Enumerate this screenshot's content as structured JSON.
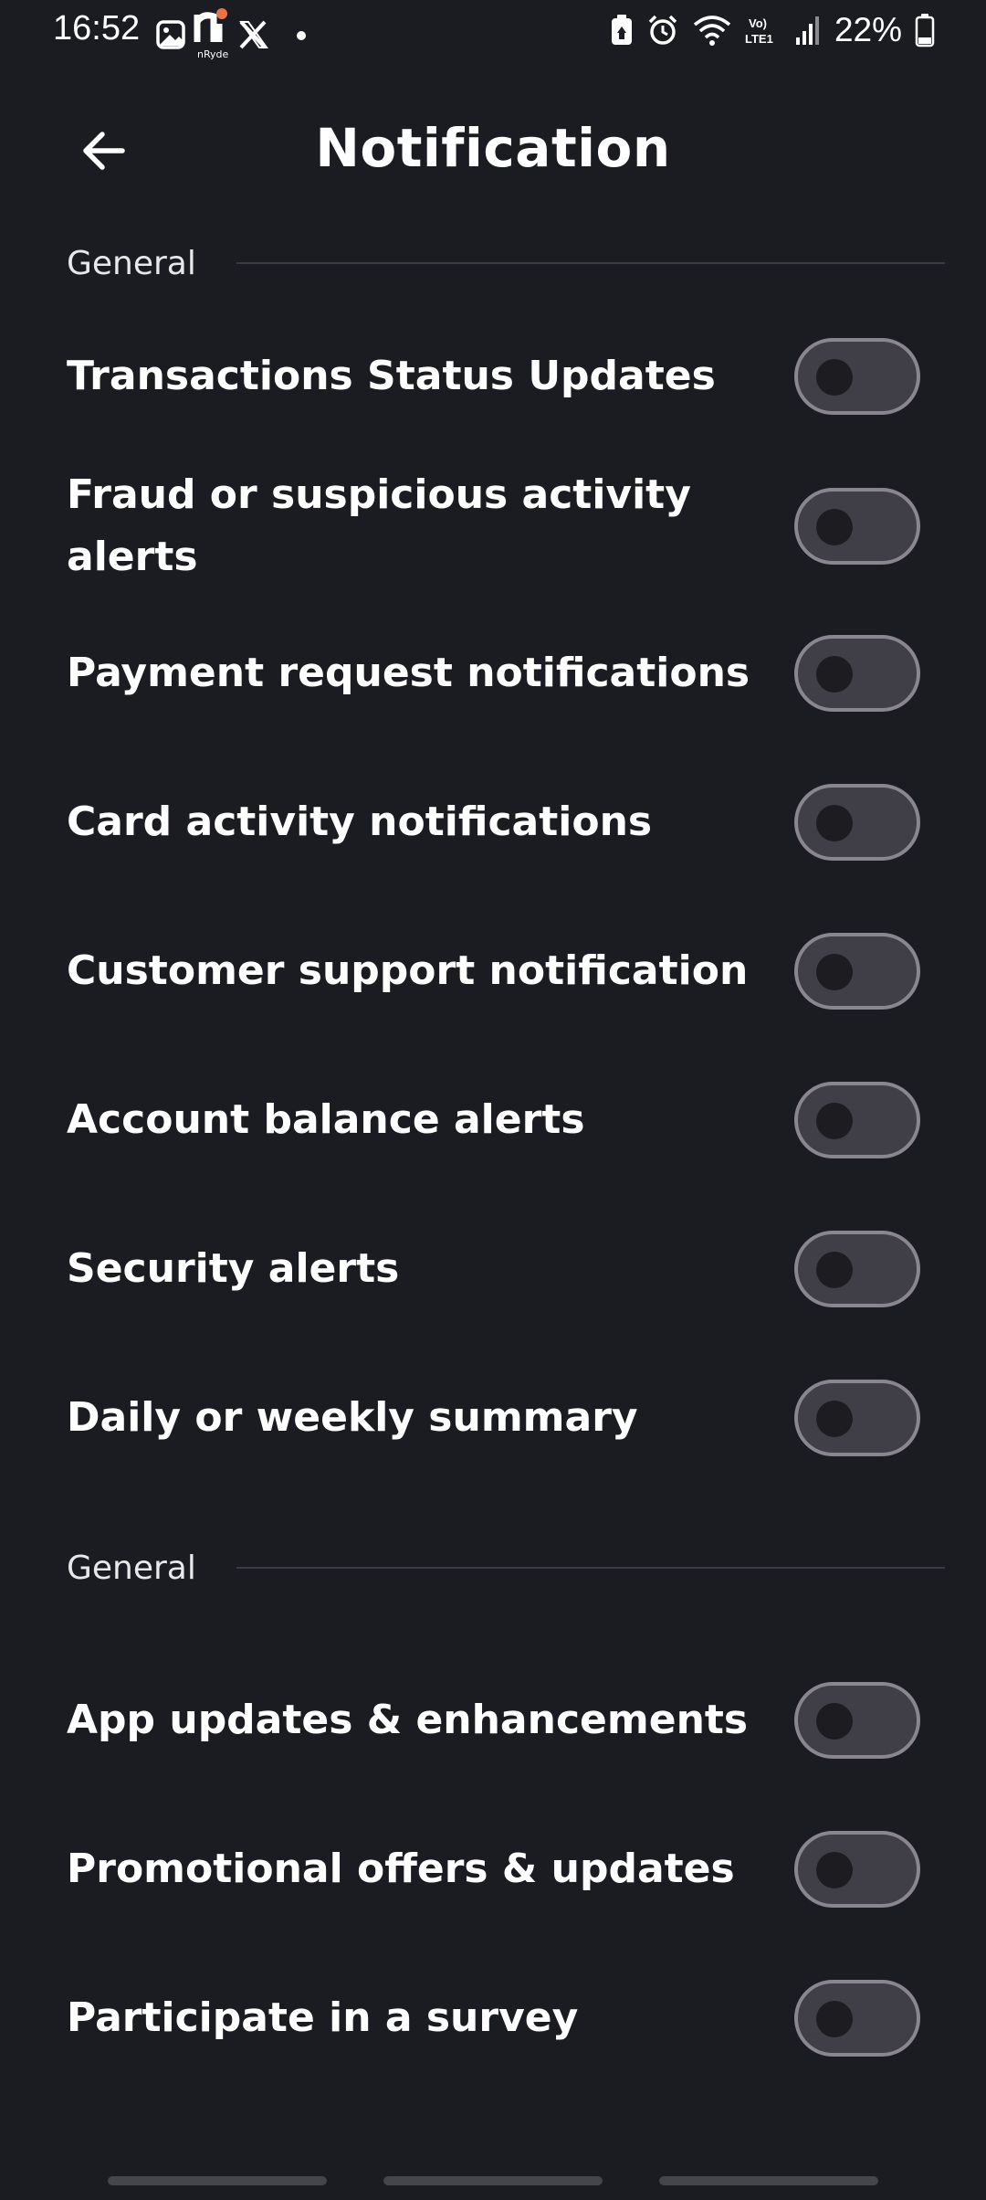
{
  "status_bar": {
    "time": "16:52",
    "battery": "22%",
    "left_icons": [
      "gallery-icon",
      "nryde-app-icon",
      "x-app-icon",
      "dot-icon"
    ],
    "nryde_caption": "nRyde",
    "right_icons": [
      "battery-saver-icon",
      "alarm-icon",
      "wifi-icon",
      "volte-icon",
      "signal-icon",
      "battery-icon"
    ],
    "volte_label": "Vo) LTE1"
  },
  "header": {
    "title": "Notification",
    "back_icon": "arrow-left-icon"
  },
  "sections": [
    {
      "label": "General",
      "items": [
        {
          "label": "Transactions Status Updates",
          "enabled": false
        },
        {
          "label": "Fraud or suspicious activity alerts",
          "enabled": false
        },
        {
          "label": "Payment request notifications",
          "enabled": false
        },
        {
          "label": "Card activity notifications",
          "enabled": false
        },
        {
          "label": "Customer support notification",
          "enabled": false
        },
        {
          "label": "Account balance alerts",
          "enabled": false
        },
        {
          "label": "Security alerts",
          "enabled": false
        },
        {
          "label": "Daily or weekly summary",
          "enabled": false
        }
      ]
    },
    {
      "label": "General",
      "items": [
        {
          "label": "App updates & enhancements",
          "enabled": false
        },
        {
          "label": "Promotional offers & updates",
          "enabled": false
        },
        {
          "label": "Participate in a survey",
          "enabled": false
        }
      ]
    }
  ],
  "colors": {
    "background": "#1b1c21",
    "toggle_track": "#403e47",
    "toggle_border": "#8a868f",
    "toggle_knob": "#1c1c21",
    "accent": "#e8734a"
  }
}
